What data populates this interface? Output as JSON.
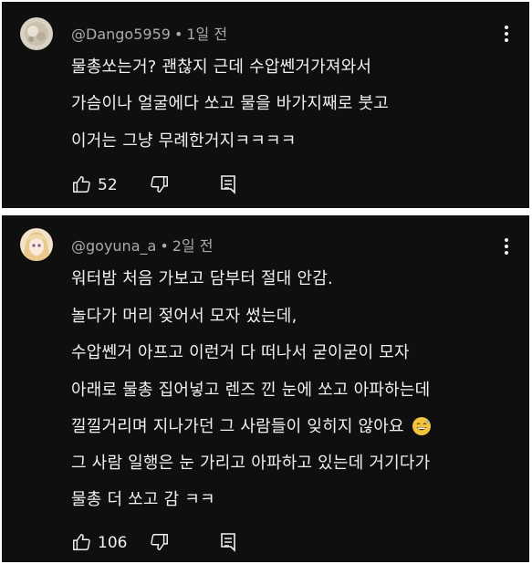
{
  "comments": [
    {
      "handle": "@Dango5959",
      "separator": "•",
      "time": "1일 전",
      "lines": [
        "물총쏘는거? 괜찮지 근데 수압쎈거가져와서",
        "가슴이나 얼굴에다 쏘고 물을 바가지째로 붓고",
        "이거는 그냥 무례한거지ㅋㅋㅋㅋ"
      ],
      "likes": "52"
    },
    {
      "handle": "@goyuna_a",
      "separator": "•",
      "time": "2일 전",
      "lines": [
        "워터밤 처음 가보고 담부터 절대 안감.",
        "놀다가 머리 젖어서 모자 썼는데,",
        "수압쎈거 아프고 이런거 다 떠나서 굳이굳이 모자",
        "아래로 물총 집어넣고 렌즈 낀 눈에 쏘고 아파하는데",
        "낄낄거리며 지나가던 그 사람들이 잊히지 않아요",
        "그 사람 일행은 눈 가리고 아파하고 있는데 거기다가",
        "물총 더 쏘고 감 ㅋㅋ"
      ],
      "emoji": "grinning-sweat-emoji",
      "likes": "106"
    }
  ],
  "icons": {
    "like": "thumbs-up-icon",
    "dislike": "thumbs-down-icon",
    "reply": "reply-icon",
    "more": "more-vert-icon"
  }
}
